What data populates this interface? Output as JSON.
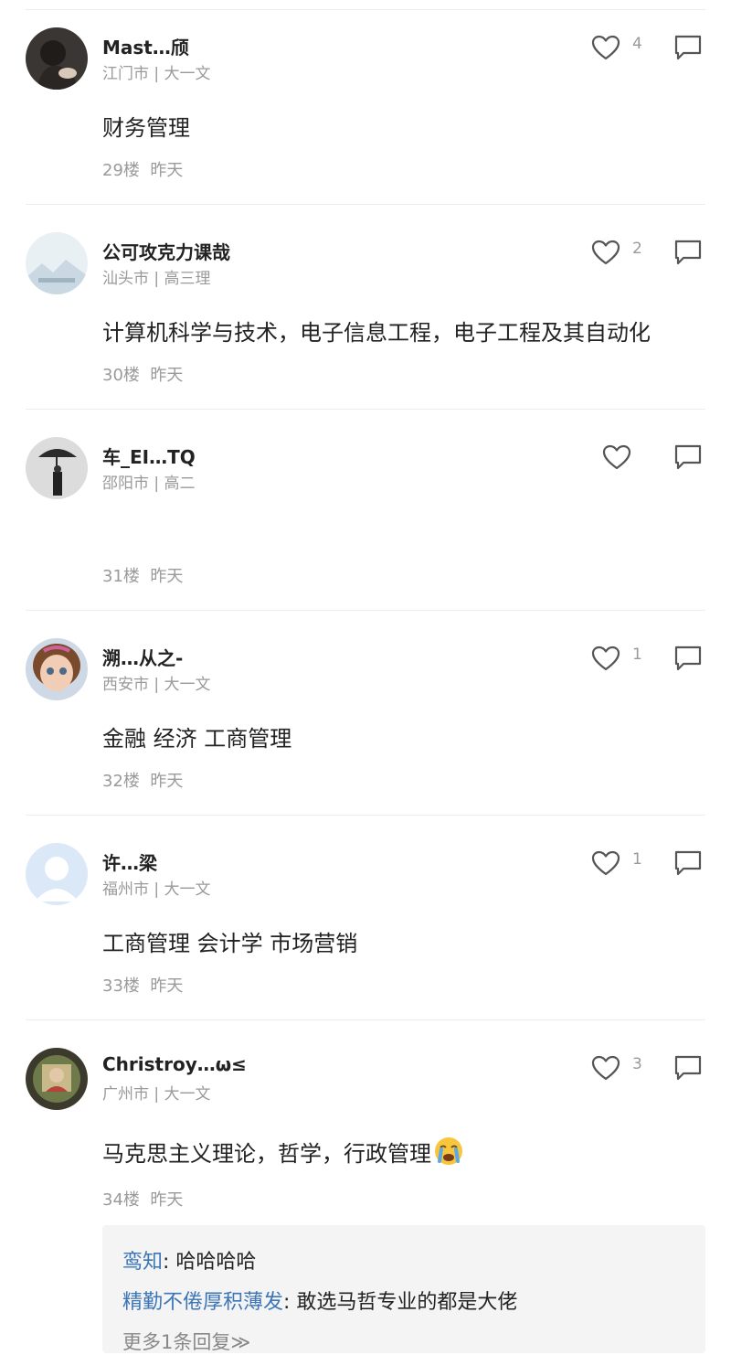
{
  "comments": [
    {
      "username": "Mast…颀",
      "location": "江门市 | 大一文",
      "content": "财务管理",
      "floor": "29楼",
      "time": "昨天",
      "likes": "4"
    },
    {
      "username": "公可攻克力课哉",
      "location": "汕头市 | 高三理",
      "content": "计算机科学与技术，电子信息工程，电子工程及其自动化",
      "floor": "30楼",
      "time": "昨天",
      "likes": "2"
    },
    {
      "username": "车_EI…TQ",
      "location": "邵阳市 | 高二",
      "content": "",
      "floor": "31楼",
      "time": "昨天",
      "likes": ""
    },
    {
      "username": "溯…从之-",
      "location": "西安市 | 大一文",
      "content": "金融 经济 工商管理",
      "floor": "32楼",
      "time": "昨天",
      "likes": "1"
    },
    {
      "username": "许…梁",
      "location": "福州市 | 大一文",
      "content": "工商管理 会计学 市场营销",
      "floor": "33楼",
      "time": "昨天",
      "likes": "1"
    },
    {
      "username": "Christroy…ω≤",
      "location": "广州市 | 大一文",
      "content": "马克思主义理论，哲学，行政管理",
      "floor": "34楼",
      "time": "昨天",
      "likes": "3",
      "emoji": "crying-face-emoji"
    }
  ],
  "replies": [
    {
      "user": "鸾知",
      "text": ": 哈哈哈哈"
    },
    {
      "user": "精勤不倦厚积薄发",
      "text": ": 敢选马哲专业的都是大佬"
    }
  ],
  "more_replies": "更多1条回复≫",
  "colors": {
    "reply_user": "#3d76b8",
    "secondary_text": "#9a9a9a",
    "reply_bg": "#f4f4f4",
    "divider": "#ececec"
  },
  "icons": {
    "like": "heart-outline-icon",
    "reply": "speech-bubble-icon"
  }
}
